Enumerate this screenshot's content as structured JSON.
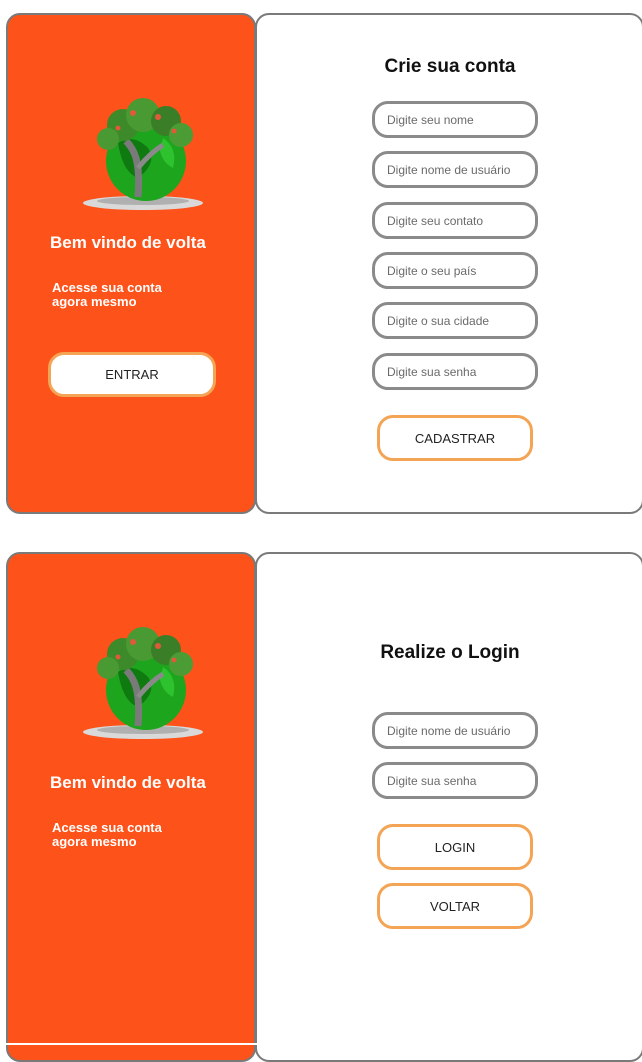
{
  "signup_screen": {
    "welcome_title": "Bem vindo de volta",
    "welcome_subtitle": "Acesse sua conta agora mesmo",
    "enter_button": "ENTRAR",
    "form_title": "Crie sua conta",
    "fields": [
      {
        "placeholder": "Digite seu nome"
      },
      {
        "placeholder": "Digite nome de usuário"
      },
      {
        "placeholder": "Digite seu contato"
      },
      {
        "placeholder": "Digite o seu país"
      },
      {
        "placeholder": "Digite o sua cidade"
      },
      {
        "placeholder": "Digite sua senha"
      }
    ],
    "submit_button": "CADASTRAR"
  },
  "login_screen": {
    "welcome_title": "Bem vindo de volta",
    "welcome_subtitle": "Acesse sua conta agora mesmo",
    "form_title": "Realize o Login",
    "fields": [
      {
        "placeholder": "Digite nome de usuário"
      },
      {
        "placeholder": "Digite sua senha"
      }
    ],
    "login_button": "LOGIN",
    "back_button": "VOLTAR"
  },
  "colors": {
    "brand_orange": "#fd5219",
    "button_border": "#f4a455",
    "input_border": "#8a8a8a"
  },
  "icons": [
    "globe-tree-logo"
  ]
}
